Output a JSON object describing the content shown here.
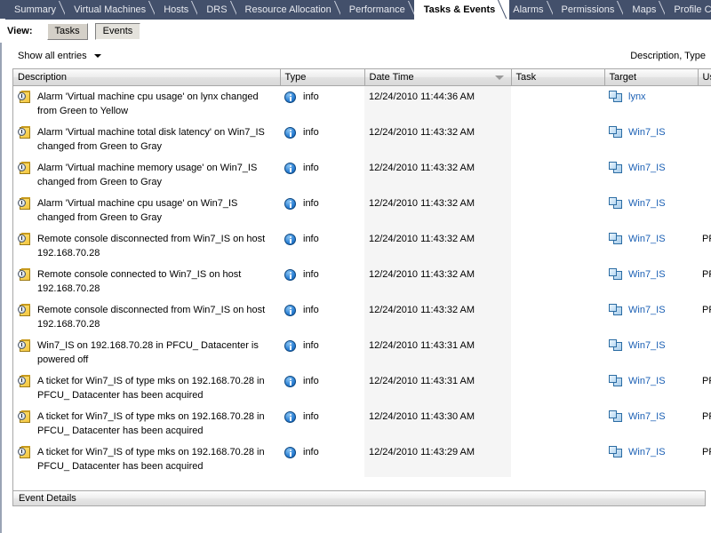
{
  "tabs": [
    {
      "label": "Summary",
      "selected": false
    },
    {
      "label": "Virtual Machines",
      "selected": false
    },
    {
      "label": "Hosts",
      "selected": false
    },
    {
      "label": "DRS",
      "selected": false
    },
    {
      "label": "Resource Allocation",
      "selected": false
    },
    {
      "label": "Performance",
      "selected": false
    },
    {
      "label": "Tasks & Events",
      "selected": true
    },
    {
      "label": "Alarms",
      "selected": false
    },
    {
      "label": "Permissions",
      "selected": false
    },
    {
      "label": "Maps",
      "selected": false
    },
    {
      "label": "Profile Compliance",
      "selected": false
    }
  ],
  "viewbar": {
    "label": "View:",
    "tasks_label": "Tasks",
    "events_label": "Events",
    "active": "Events"
  },
  "filterbar": {
    "show_entries": "Show all entries",
    "search_scope": "Description, Type"
  },
  "columns": [
    {
      "key": "description",
      "label": "Description",
      "sorted": false
    },
    {
      "key": "type",
      "label": "Type",
      "sorted": false
    },
    {
      "key": "datetime",
      "label": "Date Time",
      "sorted": true,
      "sort_dir": "desc"
    },
    {
      "key": "task",
      "label": "Task",
      "sorted": false
    },
    {
      "key": "target",
      "label": "Target",
      "sorted": false
    },
    {
      "key": "user",
      "label": "User",
      "sorted": false
    }
  ],
  "rows": [
    {
      "description": "Alarm 'Virtual machine cpu usage' on lynx changed from Green to Yellow",
      "type": "info",
      "datetime": "12/24/2010 11:44:36 AM",
      "task": "",
      "target": "lynx",
      "user": ""
    },
    {
      "description": "Alarm 'Virtual machine total disk latency' on Win7_IS changed from Green to Gray",
      "type": "info",
      "datetime": "12/24/2010 11:43:32 AM",
      "task": "",
      "target": "Win7_IS",
      "user": ""
    },
    {
      "description": "Alarm 'Virtual machine memory usage' on Win7_IS changed from Green to Gray",
      "type": "info",
      "datetime": "12/24/2010 11:43:32 AM",
      "task": "",
      "target": "Win7_IS",
      "user": ""
    },
    {
      "description": "Alarm 'Virtual machine cpu usage' on Win7_IS changed from Green to Gray",
      "type": "info",
      "datetime": "12/24/2010 11:43:32 AM",
      "task": "",
      "target": "Win7_IS",
      "user": ""
    },
    {
      "description": "Remote console disconnected from Win7_IS on host 192.168.70.28",
      "type": "info",
      "datetime": "12/24/2010 11:43:32 AM",
      "task": "",
      "target": "Win7_IS",
      "user": "PFCU\\"
    },
    {
      "description": "Remote console connected to Win7_IS on host 192.168.70.28",
      "type": "info",
      "datetime": "12/24/2010 11:43:32 AM",
      "task": "",
      "target": "Win7_IS",
      "user": "PFCU\\"
    },
    {
      "description": "Remote console disconnected from Win7_IS on host 192.168.70.28",
      "type": "info",
      "datetime": "12/24/2010 11:43:32 AM",
      "task": "",
      "target": "Win7_IS",
      "user": "PFCU\\"
    },
    {
      "description": "Win7_IS on  192.168.70.28 in PFCU_ Datacenter is powered off",
      "type": "info",
      "datetime": "12/24/2010 11:43:31 AM",
      "task": "",
      "target": "Win7_IS",
      "user": ""
    },
    {
      "description": "A ticket for Win7_IS of type mks on 192.168.70.28 in PFCU_ Datacenter has been acquired",
      "type": "info",
      "datetime": "12/24/2010 11:43:31 AM",
      "task": "",
      "target": "Win7_IS",
      "user": "PFCU\\"
    },
    {
      "description": "A ticket for Win7_IS of type mks on 192.168.70.28 in PFCU_ Datacenter has been acquired",
      "type": "info",
      "datetime": "12/24/2010 11:43:30 AM",
      "task": "",
      "target": "Win7_IS",
      "user": "PFCU\\"
    },
    {
      "description": "A ticket for Win7_IS of type mks on 192.168.70.28 in PFCU_ Datacenter has been acquired",
      "type": "info",
      "datetime": "12/24/2010 11:43:29 AM",
      "task": "",
      "target": "Win7_IS",
      "user": "PFCU\\"
    }
  ],
  "details_panel": {
    "title": "Event Details"
  },
  "colors": {
    "tabstrip_bg": "#43506b",
    "link": "#1a5fb4",
    "sorted_column_bg": "#f5f5f5",
    "header_bg": "#e2e2e2"
  }
}
